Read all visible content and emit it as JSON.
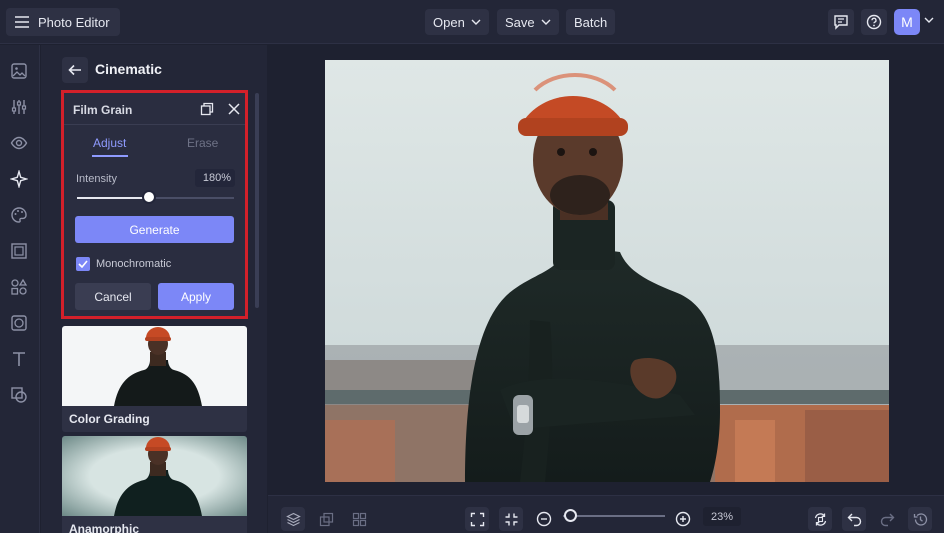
{
  "app": {
    "title": "Photo Editor"
  },
  "toolbar": {
    "open_label": "Open",
    "save_label": "Save",
    "batch_label": "Batch",
    "avatar_initial": "M"
  },
  "panel": {
    "title": "Cinematic",
    "tool": {
      "name": "Film Grain",
      "tabs": [
        "Adjust",
        "Erase"
      ],
      "active_tab": "Adjust",
      "intensity_label": "Intensity",
      "intensity_value": "180%",
      "intensity_fraction": 0.46,
      "generate_label": "Generate",
      "monochromatic_label": "Monochromatic",
      "monochromatic_checked": true,
      "cancel_label": "Cancel",
      "apply_label": "Apply"
    },
    "presets": [
      {
        "label": "Color Grading"
      },
      {
        "label": "Anamorphic"
      }
    ]
  },
  "bottom": {
    "zoom_value": "23%",
    "zoom_fraction": 0.07
  },
  "colors": {
    "accent": "#7c87f7",
    "highlight_border": "#d3202a",
    "background": "#1e2130",
    "panel": "#232637"
  },
  "icons": {
    "rail": [
      "image-icon",
      "sliders-icon",
      "eye-icon",
      "sparkle-icon",
      "palette-icon",
      "frame-icon",
      "shapes-icon",
      "texture-icon",
      "text-icon",
      "graphics-icon"
    ],
    "top": [
      "menu-icon",
      "chat-icon",
      "help-icon"
    ],
    "bottom": [
      "layers-icon",
      "clone-icon",
      "grid-icon",
      "fit-screen-icon",
      "actual-size-icon",
      "zoom-out-icon",
      "zoom-in-icon",
      "compare-icon",
      "undo-icon",
      "redo-icon",
      "history-icon"
    ]
  }
}
